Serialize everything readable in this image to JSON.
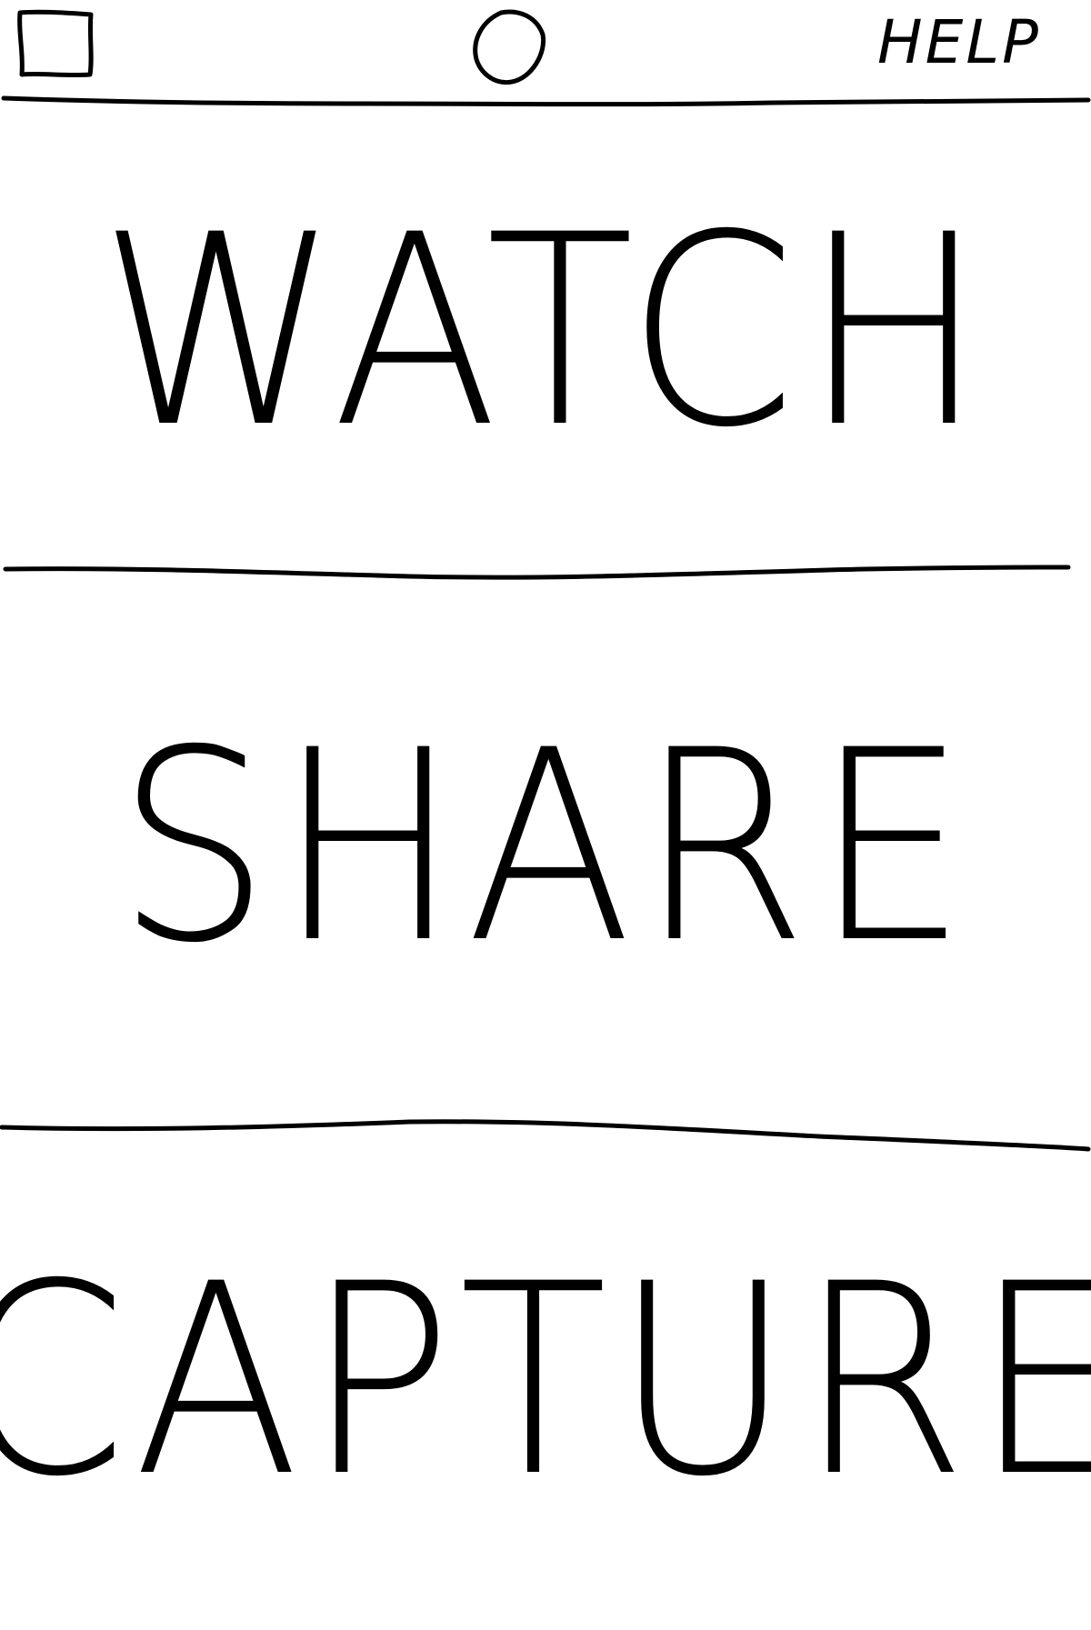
{
  "header": {
    "menu_icon": "square-icon",
    "home_icon": "circle-icon",
    "help_label": "HELP"
  },
  "sections": [
    {
      "label": "WATCH"
    },
    {
      "label": "SHARE"
    },
    {
      "label": "CAPTURE"
    }
  ],
  "colors": {
    "ink": "#000000",
    "paper": "#ffffff"
  }
}
